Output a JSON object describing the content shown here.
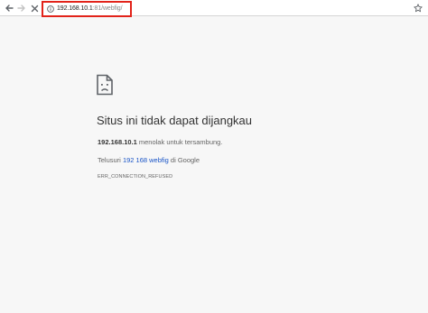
{
  "toolbar": {
    "back_icon": "arrow-left-icon",
    "forward_icon": "arrow-right-icon",
    "stop_icon": "close-icon",
    "info_icon": "info-icon",
    "star_icon": "star-icon",
    "url_host": "192.168.10.1",
    "url_rest": ":81/webfig/",
    "highlight_color": "#e2231a"
  },
  "error_page": {
    "icon": "sad-document-icon",
    "heading": "Situs ini tidak dapat dijangkau",
    "host": "192.168.10.1",
    "refused_text": " menolak untuk tersambung.",
    "search_prefix": "Telusuri ",
    "search_link": "192 168 webfig",
    "search_suffix": " di Google",
    "error_code": "ERR_CONNECTION_REFUSED",
    "link_color": "#1a55c7"
  }
}
